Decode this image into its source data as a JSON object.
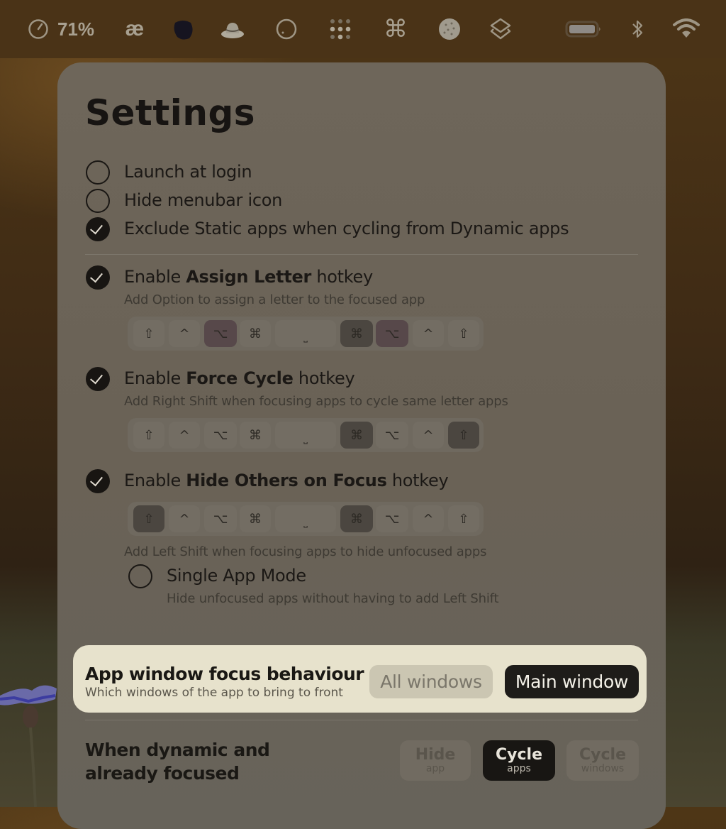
{
  "menubar": {
    "items": [
      {
        "name": "gauge-icon",
        "text": "71%"
      },
      {
        "name": "ae-ligature-icon",
        "text": "æ"
      },
      {
        "name": "dark-blob-app-icon"
      },
      {
        "name": "hat-app-icon"
      },
      {
        "name": "circle-app-icon"
      },
      {
        "name": "dot-grid-icon"
      },
      {
        "name": "command-icon",
        "text": "⌘"
      },
      {
        "name": "cookie-icon"
      },
      {
        "name": "layers-icon"
      },
      {
        "name": "battery-icon"
      },
      {
        "name": "bluetooth-icon"
      },
      {
        "name": "wifi-icon"
      }
    ]
  },
  "settings": {
    "title": "Settings",
    "general": [
      {
        "label": "Launch at login",
        "checked": false
      },
      {
        "label": "Hide menubar icon",
        "checked": false
      },
      {
        "label": "Exclude Static apps when cycling from Dynamic apps",
        "checked": true
      }
    ],
    "hotkeys": [
      {
        "prefix": "Enable ",
        "bold": "Assign Letter",
        "suffix": " hotkey",
        "checked": true,
        "description": "Add Option to assign a letter to the focused app",
        "keys": [
          {
            "glyph": "⇧",
            "selected": false
          },
          {
            "glyph": "^",
            "selected": false
          },
          {
            "glyph": "⌥",
            "selected": true
          },
          {
            "glyph": "⌘",
            "selected": false
          },
          {
            "glyph": "␣",
            "selected": false
          },
          {
            "glyph": "⌘",
            "selected": true
          },
          {
            "glyph": "⌥",
            "selected": true
          },
          {
            "glyph": "^",
            "selected": false
          },
          {
            "glyph": "⇧",
            "selected": false
          }
        ]
      },
      {
        "prefix": "Enable ",
        "bold": "Force Cycle",
        "suffix": " hotkey",
        "checked": true,
        "description": "Add Right Shift when focusing apps to cycle same letter apps",
        "keys": [
          {
            "glyph": "⇧",
            "selected": false
          },
          {
            "glyph": "^",
            "selected": false
          },
          {
            "glyph": "⌥",
            "selected": false
          },
          {
            "glyph": "⌘",
            "selected": false
          },
          {
            "glyph": "␣",
            "selected": false
          },
          {
            "glyph": "⌘",
            "selected": true
          },
          {
            "glyph": "⌥",
            "selected": false
          },
          {
            "glyph": "^",
            "selected": false
          },
          {
            "glyph": "⇧",
            "selected": true
          }
        ]
      },
      {
        "prefix": "Enable ",
        "bold": "Hide Others on Focus",
        "suffix": " hotkey",
        "checked": true,
        "description": "Add Left Shift when focusing apps to hide unfocused apps",
        "keys": [
          {
            "glyph": "⇧",
            "selected": true
          },
          {
            "glyph": "^",
            "selected": false
          },
          {
            "glyph": "⌥",
            "selected": false
          },
          {
            "glyph": "⌘",
            "selected": false
          },
          {
            "glyph": "␣",
            "selected": false
          },
          {
            "glyph": "⌘",
            "selected": true
          },
          {
            "glyph": "⌥",
            "selected": false
          },
          {
            "glyph": "^",
            "selected": false
          },
          {
            "glyph": "⇧",
            "selected": false
          }
        ],
        "sub_option": {
          "label": "Single App Mode",
          "checked": false,
          "description": "Hide unfocused apps without having to add Left Shift"
        }
      }
    ],
    "focus_behaviour": {
      "title": "App window focus behaviour",
      "description": "Which windows of the app to bring to front",
      "options": [
        "All windows",
        "Main window"
      ],
      "selected": "Main window"
    },
    "dynamic_focused": {
      "title_line1": "When dynamic and",
      "title_line2": "already focused",
      "options": [
        {
          "title": "Hide",
          "subtitle": "app"
        },
        {
          "title": "Cycle",
          "subtitle": "apps"
        },
        {
          "title": "Cycle",
          "subtitle": "windows"
        }
      ],
      "selected": 1
    }
  }
}
